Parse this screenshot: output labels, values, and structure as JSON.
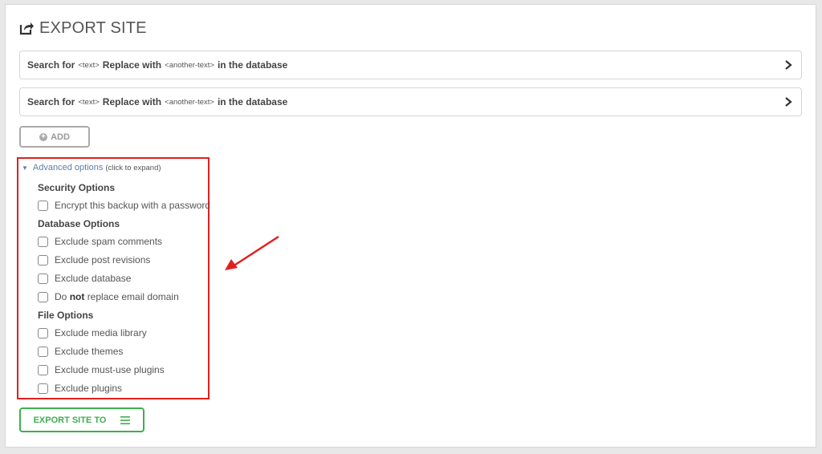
{
  "header": {
    "title": "EXPORT SITE",
    "icon": "export-icon"
  },
  "replace_rows": [
    {
      "search_label": "Search for",
      "search_placeholder": "<text>",
      "replace_label": "Replace with",
      "replace_placeholder": "<another-text>",
      "suffix": "in the database"
    },
    {
      "search_label": "Search for",
      "search_placeholder": "<text>",
      "replace_label": "Replace with",
      "replace_placeholder": "<another-text>",
      "suffix": "in the database"
    }
  ],
  "add_button": {
    "label": "ADD"
  },
  "advanced": {
    "title": "Advanced options",
    "hint": "(click to expand)",
    "sections": {
      "security": "Security Options",
      "database": "Database Options",
      "file": "File Options"
    },
    "options": {
      "encrypt": "Encrypt this backup with a password",
      "spam": "Exclude spam comments",
      "revisions": "Exclude post revisions",
      "database": "Exclude database",
      "email_pre": "Do",
      "email_bold": "not",
      "email_post": "replace email domain",
      "media": "Exclude media library",
      "themes": "Exclude themes",
      "mu_plugins": "Exclude must-use plugins",
      "plugins": "Exclude plugins"
    }
  },
  "export_button": {
    "label": "EXPORT SITE TO"
  },
  "colors": {
    "accent_green": "#3fae4f",
    "highlight_red": "#e02020",
    "link_blue": "#5b7fa6"
  }
}
